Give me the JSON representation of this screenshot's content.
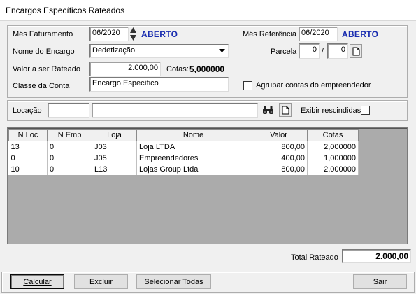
{
  "window": {
    "title": "Encargos Específicos Rateados"
  },
  "form": {
    "mes_faturamento_label": "Mês Faturamento",
    "mes_faturamento_value": "06/2020",
    "mes_faturamento_status": "ABERTO",
    "mes_referencia_label": "Mês Referência",
    "mes_referencia_value": "06/2020",
    "mes_referencia_status": "ABERTO",
    "nome_encargo_label": "Nome do Encargo",
    "nome_encargo_value": "Dedetização",
    "parcela_label": "Parcela",
    "parcela_value1": "0",
    "parcela_sep": "/",
    "parcela_value2": "0",
    "valor_rateado_label": "Valor a ser Rateado",
    "valor_rateado_value": "2.000,00",
    "cotas_label": "Cotas:",
    "cotas_value": "5,000000",
    "classe_conta_label": "Classe da Conta",
    "classe_conta_value": "Encargo Específico",
    "agrupar_label": "Agrupar contas do empreendedor",
    "agrupar_checked": false
  },
  "locacao": {
    "label": "Locação",
    "code_value": "",
    "name_value": "",
    "exibir_label": "Exibir rescindidas",
    "exibir_checked": false,
    "search_icon": "binoculars-icon",
    "new_icon": "new-document-icon"
  },
  "grid": {
    "columns": [
      "N Loc",
      "N Emp",
      "Loja",
      "Nome",
      "Valor",
      "Cotas"
    ],
    "rows": [
      [
        "13",
        "0",
        "J03",
        "Loja LTDA",
        "800,00",
        "2,000000"
      ],
      [
        "0",
        "0",
        "J05",
        "Empreendedores",
        "400,00",
        "1,000000"
      ],
      [
        "10",
        "0",
        "L13",
        "Lojas Group Ltda",
        "800,00",
        "2,000000"
      ]
    ]
  },
  "footer": {
    "total_label": "Total Rateado",
    "total_value": "2.000,00"
  },
  "buttons": {
    "calcular": "Calcular",
    "excluir": "Excluir",
    "selecionar_todas": "Selecionar Todas",
    "sair": "Sair"
  }
}
